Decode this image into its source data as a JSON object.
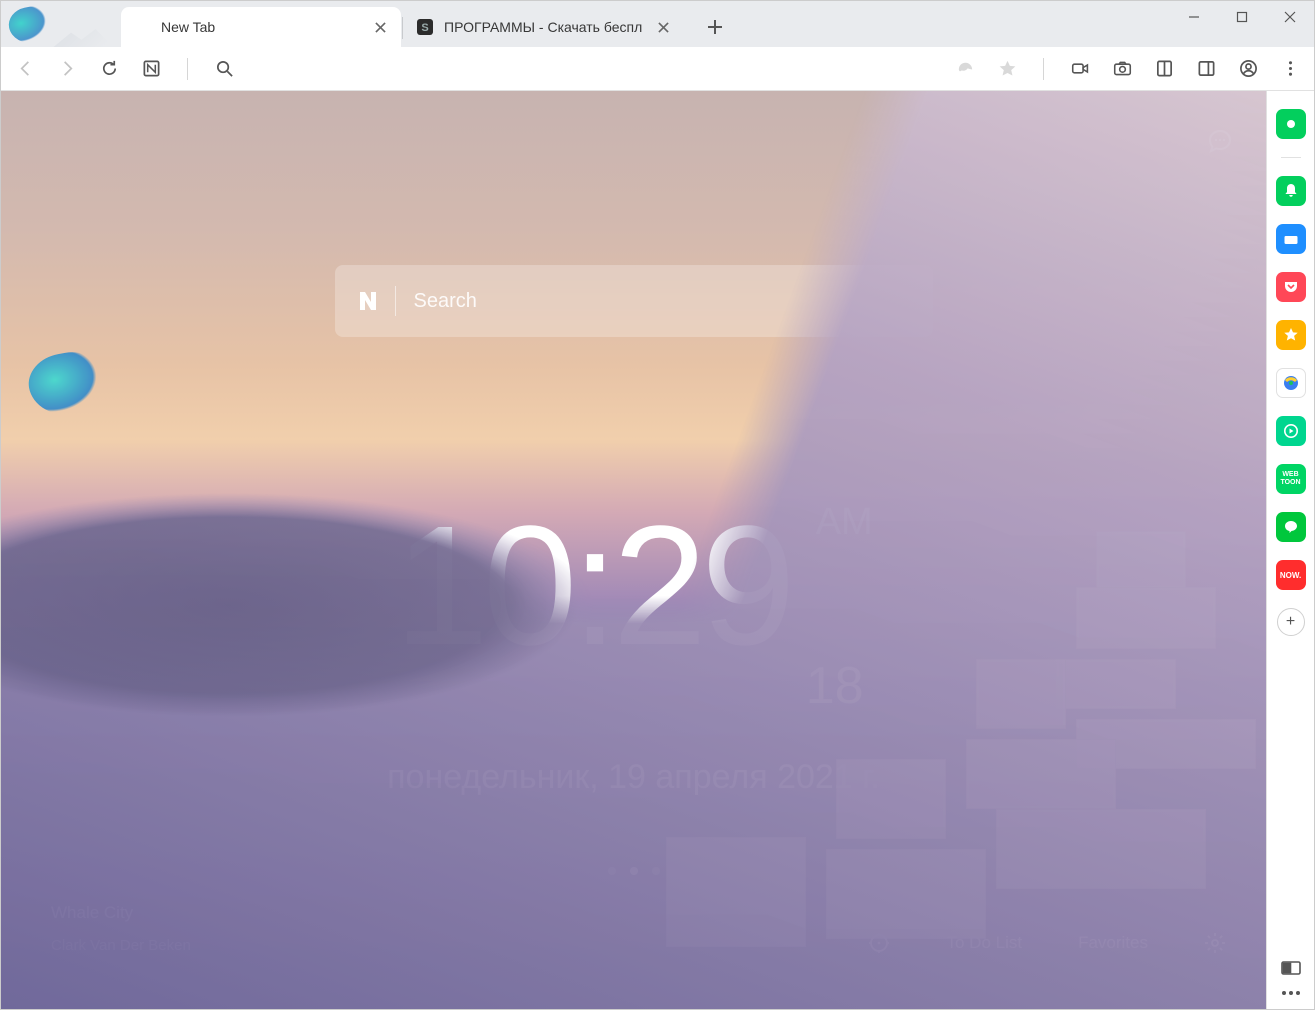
{
  "window": {
    "min": "minimize",
    "max": "maximize",
    "close": "close"
  },
  "tabs": [
    {
      "title": "New Tab",
      "active": true
    },
    {
      "title": "ПРОГРАММЫ - Скачать беспл",
      "active": false
    }
  ],
  "toolbar": {
    "back": "Back",
    "forward": "Forward",
    "reload": "Reload",
    "naver": "Naver home",
    "search": "Search/Address"
  },
  "toolbar_right": {
    "whale": "Whale",
    "bookmark": "Bookmark",
    "capture_video": "Record",
    "camera": "Capture",
    "reader": "Reader mode",
    "side_panel": "Side panel",
    "profile": "Profile",
    "menu": "Menu"
  },
  "content": {
    "bubble": "Comments",
    "search_placeholder": "Search",
    "clock": {
      "time": "10:29",
      "ampm": "AM",
      "seconds": "18"
    },
    "date": "понедельник, 19 апреля 2021 г.",
    "credit_title": "Whale City",
    "credit_author": "Clark Van Der Beken",
    "bottom": {
      "target": "Focus",
      "todo": "To Do List",
      "favorites": "Favorites",
      "settings": "Settings"
    }
  },
  "sidebar": {
    "items": [
      {
        "name": "whale-extension",
        "bg": "#03cf5d",
        "glyph": "●"
      },
      {
        "name": "notifications",
        "bg": "#03cf5d",
        "glyph": "bell"
      },
      {
        "name": "toolbox",
        "bg": "#1f8fff",
        "glyph": "case"
      },
      {
        "name": "pocket",
        "bg": "#ff4757",
        "glyph": "pocket"
      },
      {
        "name": "bookmarks",
        "bg": "#ffb300",
        "glyph": "star"
      },
      {
        "name": "translate",
        "bg": "#ffffff",
        "glyph": "globe"
      },
      {
        "name": "music",
        "bg": "#00d68f",
        "glyph": "play"
      },
      {
        "name": "webtoon",
        "bg": "#00d564",
        "glyph": "WEB"
      },
      {
        "name": "line",
        "bg": "#00c73c",
        "glyph": "chat"
      },
      {
        "name": "now",
        "bg": "#ff2d2d",
        "glyph": "NOW."
      }
    ],
    "add": "+"
  }
}
